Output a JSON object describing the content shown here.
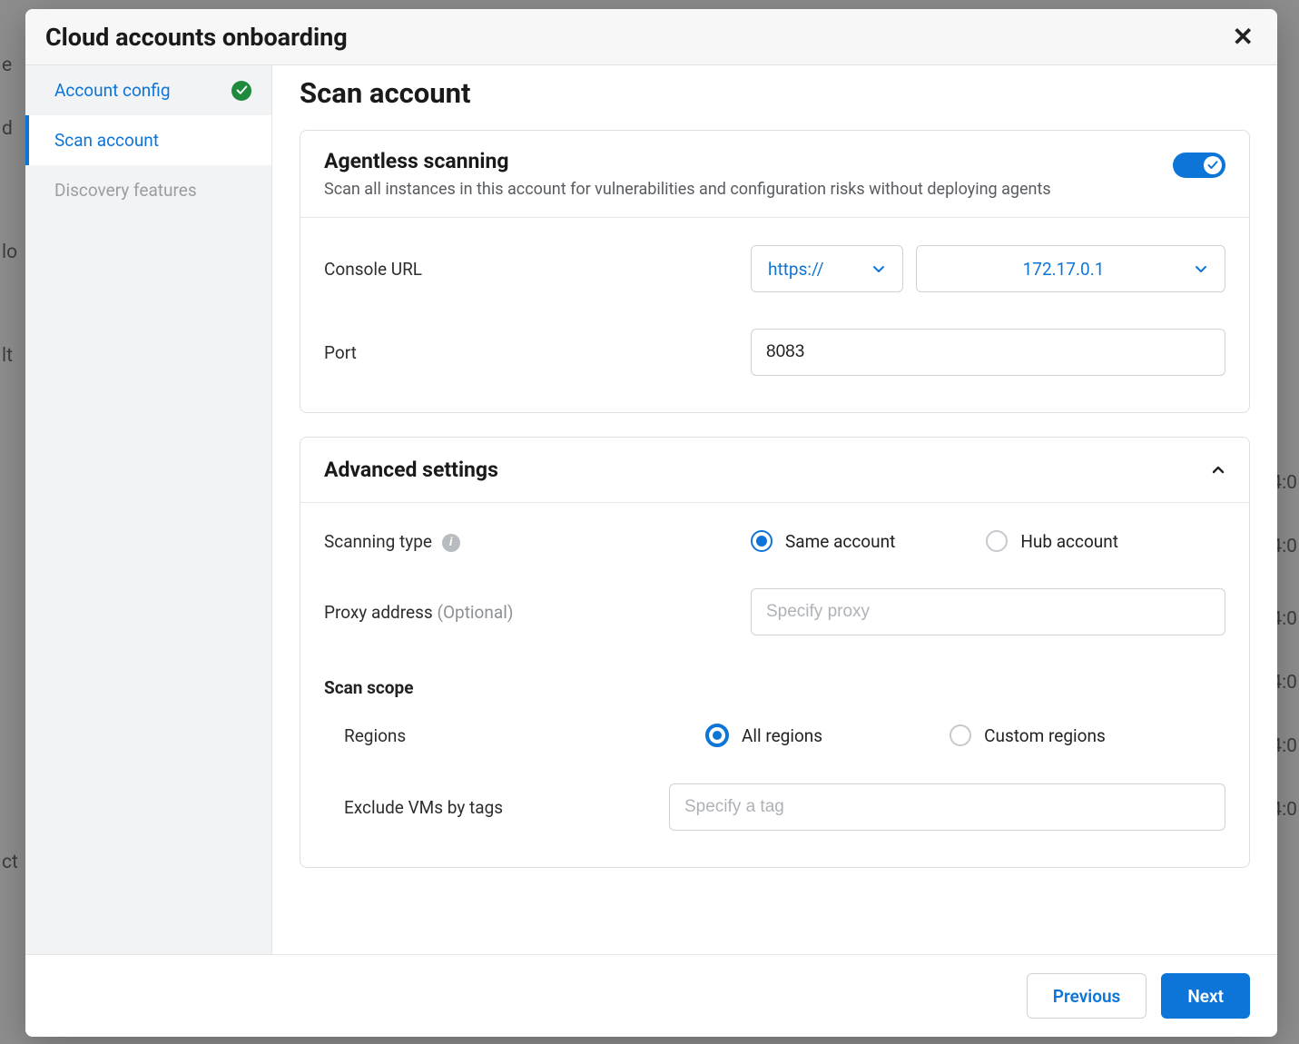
{
  "background": {
    "fragments": [
      "d",
      "e",
      "lo",
      "lt",
      "4:0",
      "4:0",
      "4:0",
      "4:0",
      "4:0",
      "4:0",
      "ct"
    ]
  },
  "modal": {
    "title": "Cloud accounts onboarding",
    "close_label": "Close"
  },
  "sidebar": {
    "items": [
      {
        "label": "Account config",
        "state": "complete"
      },
      {
        "label": "Scan account",
        "state": "active"
      },
      {
        "label": "Discovery features",
        "state": "disabled"
      }
    ]
  },
  "main": {
    "title": "Scan account",
    "agentless": {
      "title": "Agentless scanning",
      "subtitle": "Scan all instances in this account for vulnerabilities and configuration risks without deploying agents",
      "toggle_on": true,
      "console_url_label": "Console URL",
      "console_scheme": "https://",
      "console_host": "172.17.0.1",
      "port_label": "Port",
      "port_value": "8083"
    },
    "advanced": {
      "title": "Advanced settings",
      "expanded": true,
      "scanning_type_label": "Scanning type",
      "scanning_type_options": [
        {
          "label": "Same account",
          "selected": true
        },
        {
          "label": "Hub account",
          "selected": false
        }
      ],
      "proxy_label": "Proxy address",
      "proxy_optional": "(Optional)",
      "proxy_placeholder": "Specify proxy",
      "proxy_value": "",
      "scan_scope_title": "Scan scope",
      "regions_label": "Regions",
      "regions_options": [
        {
          "label": "All regions",
          "selected": true
        },
        {
          "label": "Custom regions",
          "selected": false
        }
      ],
      "exclude_tags_label": "Exclude VMs by tags",
      "exclude_tags_placeholder": "Specify a tag",
      "exclude_tags_value": ""
    }
  },
  "footer": {
    "previous": "Previous",
    "next": "Next"
  }
}
